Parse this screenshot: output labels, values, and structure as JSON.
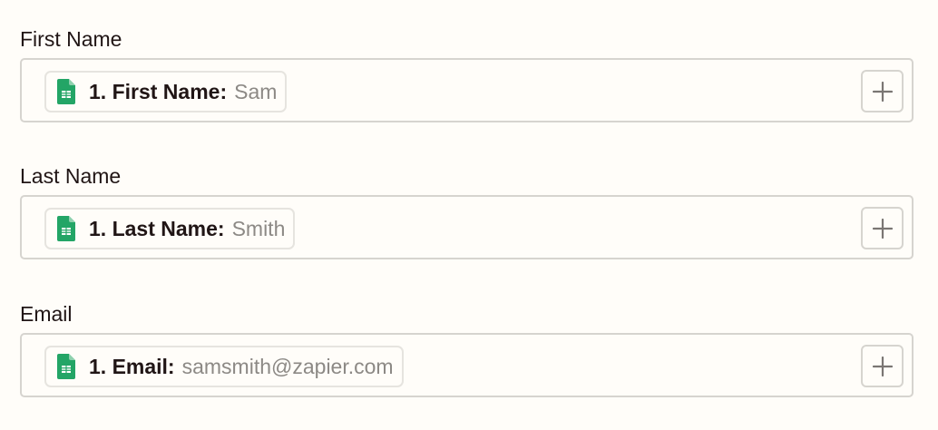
{
  "fields": [
    {
      "label": "First Name",
      "pill_key": "1. First Name:",
      "pill_value": "Sam",
      "pill_icon": "google-sheets-icon",
      "action_icon": "plus-icon"
    },
    {
      "label": "Last Name",
      "pill_key": "1. Last Name:",
      "pill_value": "Smith",
      "pill_icon": "google-sheets-icon",
      "action_icon": "plus-icon"
    },
    {
      "label": "Email",
      "pill_key": "1. Email:",
      "pill_value": "samsmith@zapier.com",
      "pill_icon": "google-sheets-icon",
      "action_icon": "plus-icon"
    }
  ],
  "colors": {
    "background": "#fffdf9",
    "text": "#201515",
    "muted_text": "#8c8985",
    "border": "#d6d4cf",
    "sheets_green": "#23a566"
  }
}
